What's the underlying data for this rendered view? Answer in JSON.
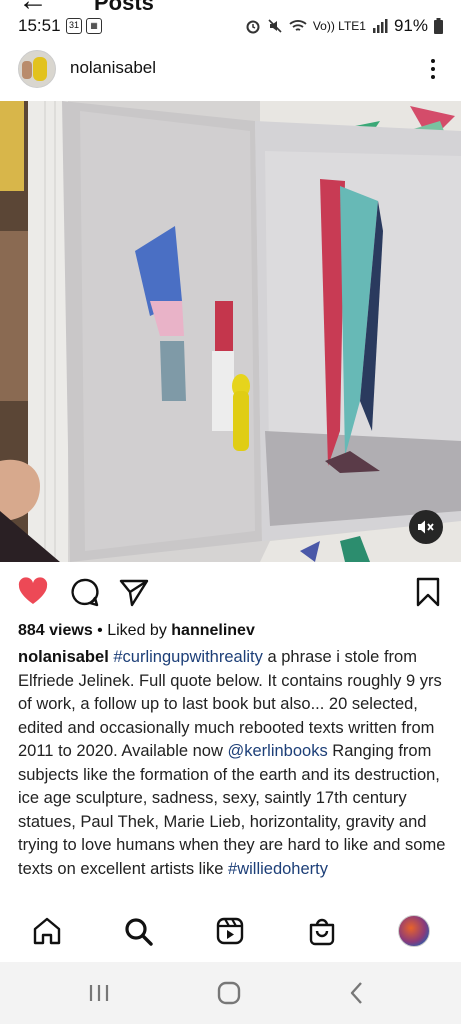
{
  "header": {
    "back_glyph": "←",
    "title": "Posts"
  },
  "status_bar": {
    "time": "15:51",
    "notif_1": "31",
    "network_text": "Vo)) LTE1",
    "battery": "91%"
  },
  "post": {
    "username": "nolanisabel",
    "views": "884 views",
    "liked_by_prefix": " • Liked by ",
    "liked_by_user": "hannelinev",
    "caption_user": "nolanisabel",
    "caption_tag": "#curlingupwithreality",
    "caption_text": " a phrase i stole from Elfriede Jelinek. Full quote below. It contains roughly 9 yrs of work, a follow up to last book but also... 20 selected, edited and occasionally much rebooted texts written from 2011 to 2020. Available now ",
    "caption_mention": "@kerlinbooks",
    "caption_text_2": " Ranging from subjects like the formation of the earth and its destruction, ice age sculpture, sadness, sexy, saintly 17th century statues, Paul Thek,  Marie Lieb, horizontality, gravity and trying to love humans when they are hard to like  and some texts on excellent artists like ",
    "caption_tag_2": "#williedoherty"
  },
  "icons": {
    "like": "heart-icon",
    "comment": "comment-icon",
    "share": "send-icon",
    "save": "bookmark-icon",
    "mute": "muted-speaker-icon",
    "home": "home-icon",
    "search": "search-icon",
    "reels": "reels-icon",
    "shop": "shop-icon"
  },
  "colors": {
    "like_red": "#ed4956",
    "link_blue": "#1d3f78"
  }
}
